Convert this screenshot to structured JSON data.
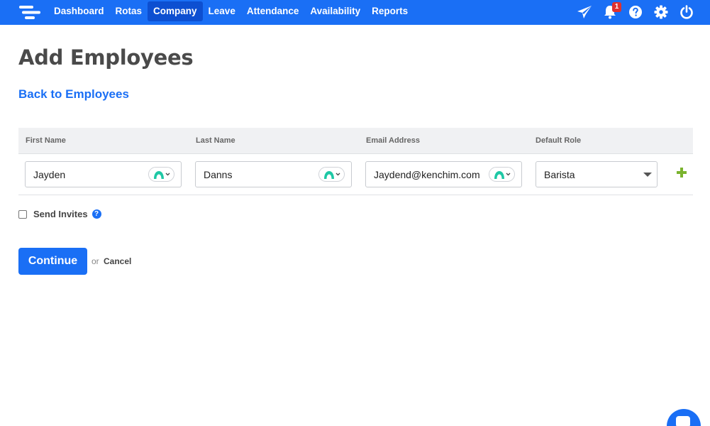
{
  "nav": {
    "items": [
      {
        "label": "Dashboard",
        "active": false
      },
      {
        "label": "Rotas",
        "active": false
      },
      {
        "label": "Company",
        "active": true
      },
      {
        "label": "Leave",
        "active": false
      },
      {
        "label": "Attendance",
        "active": false
      },
      {
        "label": "Availability",
        "active": false
      },
      {
        "label": "Reports",
        "active": false
      }
    ],
    "notification_count": "1",
    "icons": [
      "paper-plane-icon",
      "bell-icon",
      "help-icon",
      "gear-icon",
      "power-icon"
    ]
  },
  "page": {
    "title": "Add Employees",
    "back_link": "Back to Employees"
  },
  "table": {
    "headers": {
      "first_name": "First Name",
      "last_name": "Last Name",
      "email": "Email Address",
      "role": "Default Role"
    },
    "row": {
      "first_name": "Jayden",
      "last_name": "Danns",
      "email": "Jaydend@kenchim.com",
      "role": "Barista"
    }
  },
  "invite": {
    "label": "Send Invites",
    "checked": false,
    "help": "?"
  },
  "actions": {
    "continue": "Continue",
    "or": "or",
    "cancel": "Cancel"
  },
  "colors": {
    "primary": "#1a6ff5",
    "nav_active": "#0d4fd1",
    "add": "#7ab32e",
    "badge": "#e0312f",
    "password_manager": "#1ec8a5"
  }
}
